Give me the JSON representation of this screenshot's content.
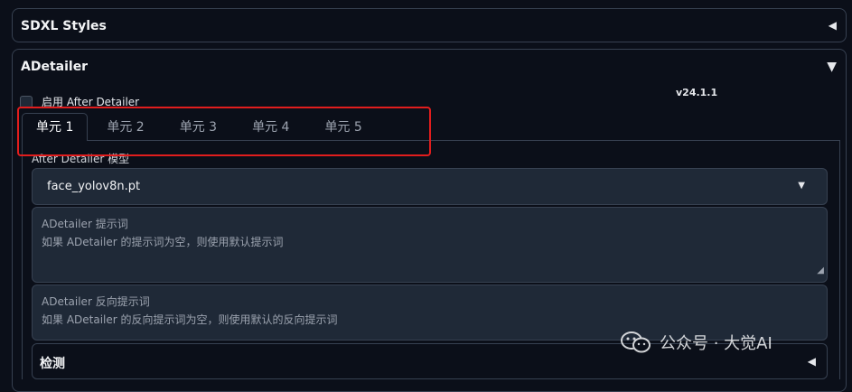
{
  "sdxl": {
    "title": "SDXL Styles"
  },
  "adetailer": {
    "title": "ADetailer",
    "enable_label": "启用 After Detailer",
    "version": "v24.1.1",
    "tabs": [
      {
        "label": "单元 1"
      },
      {
        "label": "单元 2"
      },
      {
        "label": "单元 3"
      },
      {
        "label": "单元 4"
      },
      {
        "label": "单元 5"
      }
    ],
    "model_label": "After Detailer 模型",
    "model_value": "face_yolov8n.pt",
    "prompt": {
      "line1": "ADetailer 提示词",
      "line2": "如果 ADetailer 的提示词为空，则使用默认提示词"
    },
    "neg_prompt": {
      "line1": "ADetailer 反向提示词",
      "line2": "如果 ADetailer 的反向提示词为空，则使用默认的反向提示词"
    },
    "detect_title": "检测"
  },
  "watermark": {
    "text": "公众号 · 大觉AI"
  },
  "colors": {
    "highlight": "#e11d1d",
    "background": "#0b0f19"
  }
}
